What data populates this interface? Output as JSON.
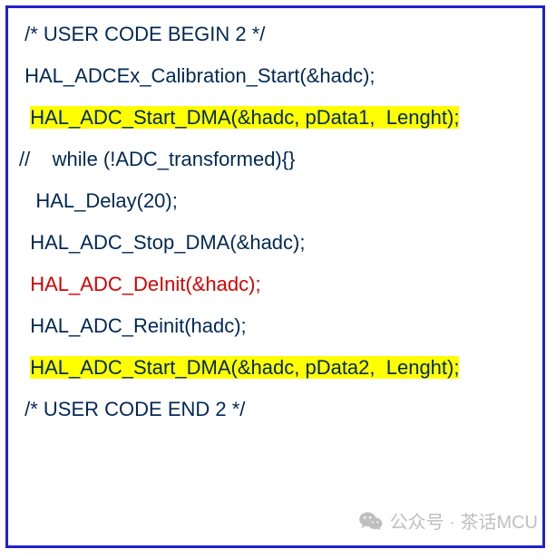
{
  "code": {
    "lines": [
      {
        "indent": " ",
        "text": "/* USER CODE BEGIN 2 */",
        "style": "plain"
      },
      {
        "indent": " ",
        "text": "HAL_ADCEx_Calibration_Start(&hadc);",
        "style": "plain"
      },
      {
        "indent": "  ",
        "text": "HAL_ADC_Start_DMA(&hadc, pData1,  Lenght);",
        "style": "highlight"
      },
      {
        "indent": "",
        "text": "//    while (!ADC_transformed){}",
        "style": "plain"
      },
      {
        "indent": "   ",
        "text": "HAL_Delay(20);",
        "style": "plain"
      },
      {
        "indent": "  ",
        "text": "HAL_ADC_Stop_DMA(&hadc);",
        "style": "plain"
      },
      {
        "indent": "  ",
        "text": "HAL_ADC_DeInit(&hadc);",
        "style": "red"
      },
      {
        "indent": "  ",
        "text": "HAL_ADC_Reinit(hadc);",
        "style": "plain"
      },
      {
        "indent": "  ",
        "text": "HAL_ADC_Start_DMA(&hadc, pData2,  Lenght);",
        "style": "highlight"
      },
      {
        "indent": " ",
        "text": "/* USER CODE END 2 */",
        "style": "plain"
      }
    ]
  },
  "watermark": {
    "label": "公众号 · 茶话MCU"
  }
}
